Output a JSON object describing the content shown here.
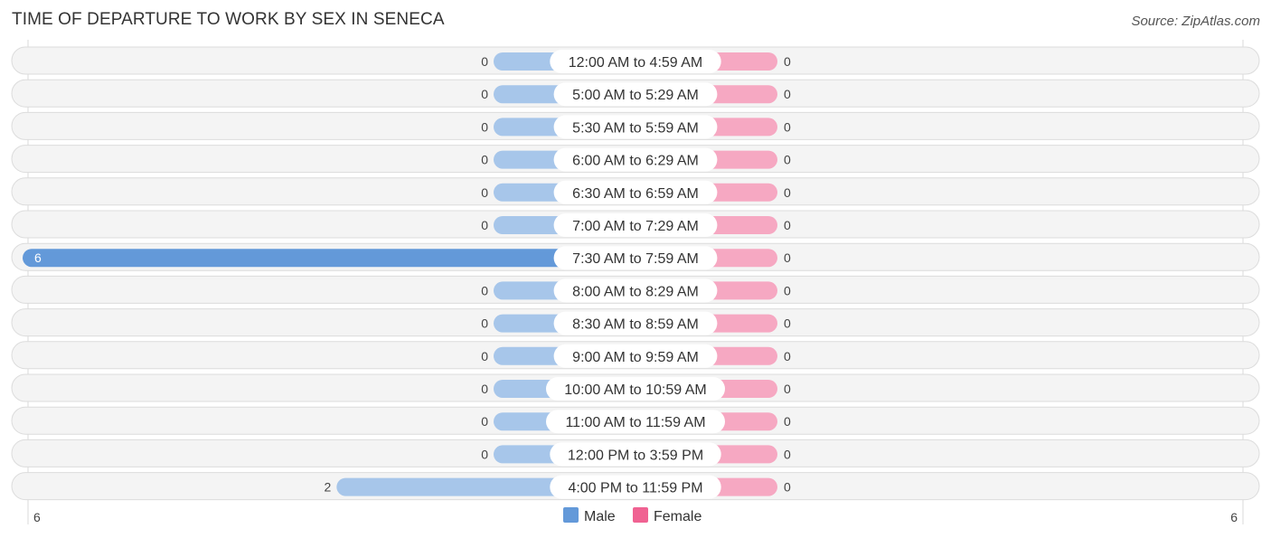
{
  "header": {
    "title": "TIME OF DEPARTURE TO WORK BY SEX IN SENECA",
    "source": "Source: ZipAtlas.com"
  },
  "colors": {
    "male_strong": "#6399d9",
    "male_light": "#a7c6ea",
    "female_strong": "#f06292",
    "female_light": "#f6a8c2"
  },
  "chart_data": {
    "type": "bar",
    "orientation": "horizontal-diverging",
    "title": "TIME OF DEPARTURE TO WORK BY SEX IN SENECA",
    "categories": [
      "12:00 AM to 4:59 AM",
      "5:00 AM to 5:29 AM",
      "5:30 AM to 5:59 AM",
      "6:00 AM to 6:29 AM",
      "6:30 AM to 6:59 AM",
      "7:00 AM to 7:29 AM",
      "7:30 AM to 7:59 AM",
      "8:00 AM to 8:29 AM",
      "8:30 AM to 8:59 AM",
      "9:00 AM to 9:59 AM",
      "10:00 AM to 10:59 AM",
      "11:00 AM to 11:59 AM",
      "12:00 PM to 3:59 PM",
      "4:00 PM to 11:59 PM"
    ],
    "series": [
      {
        "name": "Male",
        "side": "left",
        "values": [
          0,
          0,
          0,
          0,
          0,
          0,
          6,
          0,
          0,
          0,
          0,
          0,
          0,
          2
        ]
      },
      {
        "name": "Female",
        "side": "right",
        "values": [
          0,
          0,
          0,
          0,
          0,
          0,
          0,
          0,
          0,
          0,
          0,
          0,
          0,
          0
        ]
      }
    ],
    "axis": {
      "left_tick": "6",
      "right_tick": "6",
      "max": 6
    },
    "legend": {
      "position": "bottom-center",
      "entries": [
        "Male",
        "Female"
      ]
    },
    "grid": false
  }
}
